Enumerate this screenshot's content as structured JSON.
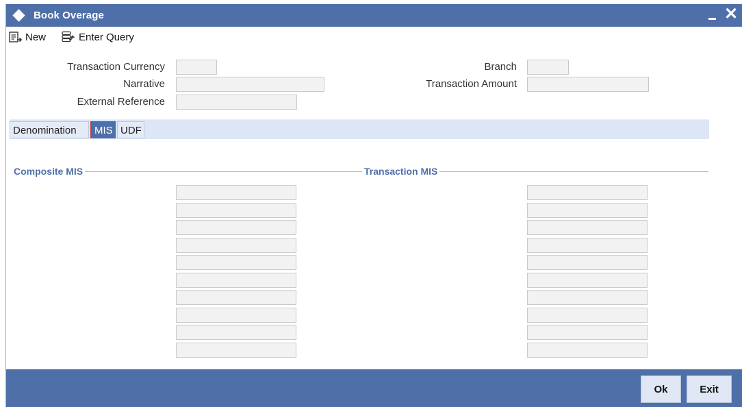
{
  "window": {
    "title": "Book Overage",
    "close_glyph": "✕"
  },
  "toolbar": {
    "new_label": "New",
    "enter_query_label": "Enter Query"
  },
  "form": {
    "transaction_currency_label": "Transaction Currency",
    "narrative_label": "Narrative",
    "external_reference_label": "External Reference",
    "branch_label": "Branch",
    "transaction_amount_label": "Transaction Amount",
    "transaction_currency_value": "",
    "narrative_value": "",
    "external_reference_value": "",
    "branch_value": "",
    "transaction_amount_value": ""
  },
  "tabs": [
    {
      "label": "Denomination",
      "active": false
    },
    {
      "label": "MIS",
      "active": true
    },
    {
      "label": "UDF",
      "active": false
    }
  ],
  "mis": {
    "composite_title": "Composite MIS",
    "transaction_title": "Transaction MIS",
    "composite_fields": [
      "",
      "",
      "",
      "",
      "",
      "",
      "",
      "",
      "",
      ""
    ],
    "transaction_fields": [
      "",
      "",
      "",
      "",
      "",
      "",
      "",
      "",
      "",
      ""
    ]
  },
  "footer": {
    "ok_label": "Ok",
    "exit_label": "Exit"
  },
  "colors": {
    "accent": "#4f6fa8",
    "tab_bar": "#dde6f6",
    "field_bg": "#f2f2f2"
  },
  "icons": {
    "title": "diamond-icon",
    "new": "new-document-icon",
    "enter_query": "enter-query-icon",
    "minimize": "minimize-icon",
    "close": "close-icon"
  }
}
